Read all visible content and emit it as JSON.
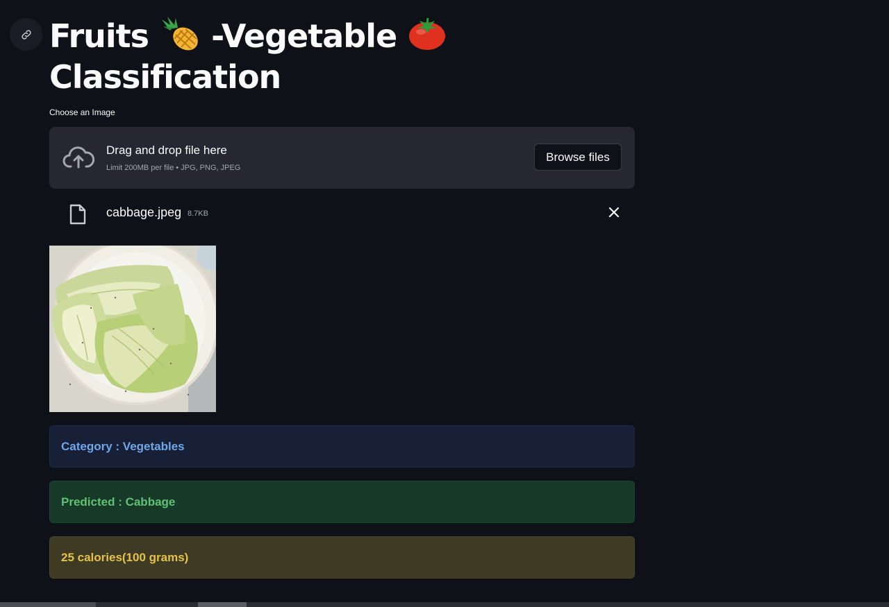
{
  "header": {
    "title_line1_a": "Fruits",
    "title_line1_b": "-Vegetable",
    "title_line2": "Classification",
    "emoji1": "pineapple-icon",
    "emoji2": "tomato-icon"
  },
  "uploader": {
    "label": "Choose an Image",
    "drop_text": "Drag and drop file here",
    "limit_text": "Limit 200MB per file • JPG, PNG, JPEG",
    "browse_label": "Browse files",
    "icon": "cloud-upload-icon"
  },
  "file": {
    "name": "cabbage.jpeg",
    "size": "8.7KB",
    "icon": "file-icon",
    "remove_icon": "close-icon"
  },
  "results": {
    "category": "Category : Vegetables",
    "predicted": "Predicted : Cabbage",
    "calories": "25 calories(100 grams)"
  },
  "colors": {
    "background": "#0e1117",
    "info": "#6fa7e8",
    "success": "#5fc274",
    "warning": "#e5c34a"
  }
}
